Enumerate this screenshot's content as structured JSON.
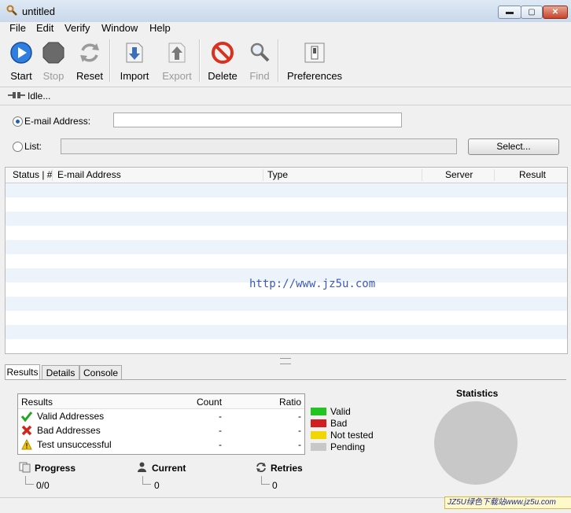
{
  "window": {
    "title": "untitled",
    "min_glyph": "▬",
    "max_glyph": "▢",
    "close_glyph": "✕"
  },
  "menu": [
    "File",
    "Edit",
    "Verify",
    "Window",
    "Help"
  ],
  "toolbar": {
    "start": "Start",
    "stop": "Stop",
    "reset": "Reset",
    "import": "Import",
    "export": "Export",
    "delete": "Delete",
    "find": "Find",
    "preferences": "Preferences"
  },
  "status": {
    "text": "Idle..."
  },
  "form": {
    "email_label": "E-mail Address:",
    "email_value": "",
    "list_label": "List:",
    "list_value": "",
    "select_button": "Select..."
  },
  "table": {
    "columns": [
      "Status | #",
      "E-mail Address",
      "Type",
      "Server",
      "Result"
    ]
  },
  "watermark": "http://www.jz5u.com",
  "tabs": [
    "Results",
    "Details",
    "Console"
  ],
  "results": {
    "headers": [
      "Results",
      "Count",
      "Ratio"
    ],
    "rows": [
      {
        "label": "Valid Addresses",
        "count": "-",
        "ratio": "-",
        "icon": "check-icon"
      },
      {
        "label": "Bad Addresses",
        "count": "-",
        "ratio": "-",
        "icon": "x-icon"
      },
      {
        "label": "Test unsuccessful",
        "count": "-",
        "ratio": "-",
        "icon": "warning-icon"
      }
    ]
  },
  "legend": [
    {
      "label": "Valid",
      "color": "#22c422"
    },
    {
      "label": "Bad",
      "color": "#d21e1e"
    },
    {
      "label": "Not tested",
      "color": "#f2d600"
    },
    {
      "label": "Pending",
      "color": "#c8c8c8"
    }
  ],
  "stats": {
    "title": "Statistics"
  },
  "progress": {
    "progress_label": "Progress",
    "progress_value": "0/0",
    "current_label": "Current",
    "current_value": "0",
    "retries_label": "Retries",
    "retries_value": "0"
  },
  "credit": "JZ5U绿色下载站www.jz5u.com"
}
